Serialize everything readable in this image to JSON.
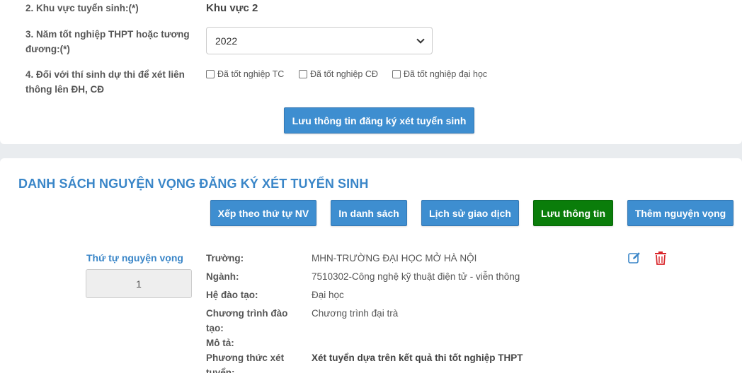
{
  "form": {
    "region_label": "2. Khu vực tuyển sinh:(*)",
    "region_value": "Khu vực 2",
    "grad_year_label_line1": "3. Năm tốt nghiệp THPT hoặc tương",
    "grad_year_label_line2": "đương:(*)",
    "grad_year_value": "2022",
    "transfer_label_line1": "4. Đối với thí sinh dự thi để xét liên",
    "transfer_label_line2": "thông lên ĐH, CĐ",
    "checkboxes": [
      {
        "label": "Đã tốt nghiệp TC",
        "checked": false
      },
      {
        "label": "Đã tốt nghiệp CĐ",
        "checked": false
      },
      {
        "label": "Đã tốt nghiệp đại học",
        "checked": false
      }
    ],
    "save_registration_label": "Lưu thông tin đăng ký xét tuyển sinh"
  },
  "wishlist": {
    "title": "DANH SÁCH NGUYỆN VỌNG ĐĂNG KÝ XÉT TUYỂN SINH",
    "buttons": {
      "sort": "Xếp theo thứ tự NV",
      "print": "In danh sách",
      "history": "Lịch sử giao dịch",
      "save": "Lưu thông tin",
      "add": "Thêm nguyện vọng"
    },
    "order_label": "Thứ tự nguyện vọng",
    "order_value": "1",
    "item": {
      "school_label": "Trường:",
      "school_value": "MHN-TRƯỜNG ĐẠI HỌC MỞ HÀ NỘI",
      "major_label": "Ngành:",
      "major_value": "7510302-Công nghệ kỹ thuật điện tử - viễn thông",
      "system_label": "Hệ đào tạo:",
      "system_value": "Đại học",
      "program_label_line1": "Chương trình đào",
      "program_label_line2": "tạo:",
      "program_value": "Chương trình đại trà",
      "desc_label": "Mô tả:",
      "method_label_line1": "Phương thức xét",
      "method_label_line2": "tuyển:",
      "method_value": "Xét tuyển dựa trên kết quả thi tốt nghiệp THPT"
    }
  },
  "colors": {
    "accent_blue": "#3e8ed0",
    "save_green": "#0a7d0a",
    "title_blue": "#3a86c8",
    "delete_red": "#d9262b"
  }
}
